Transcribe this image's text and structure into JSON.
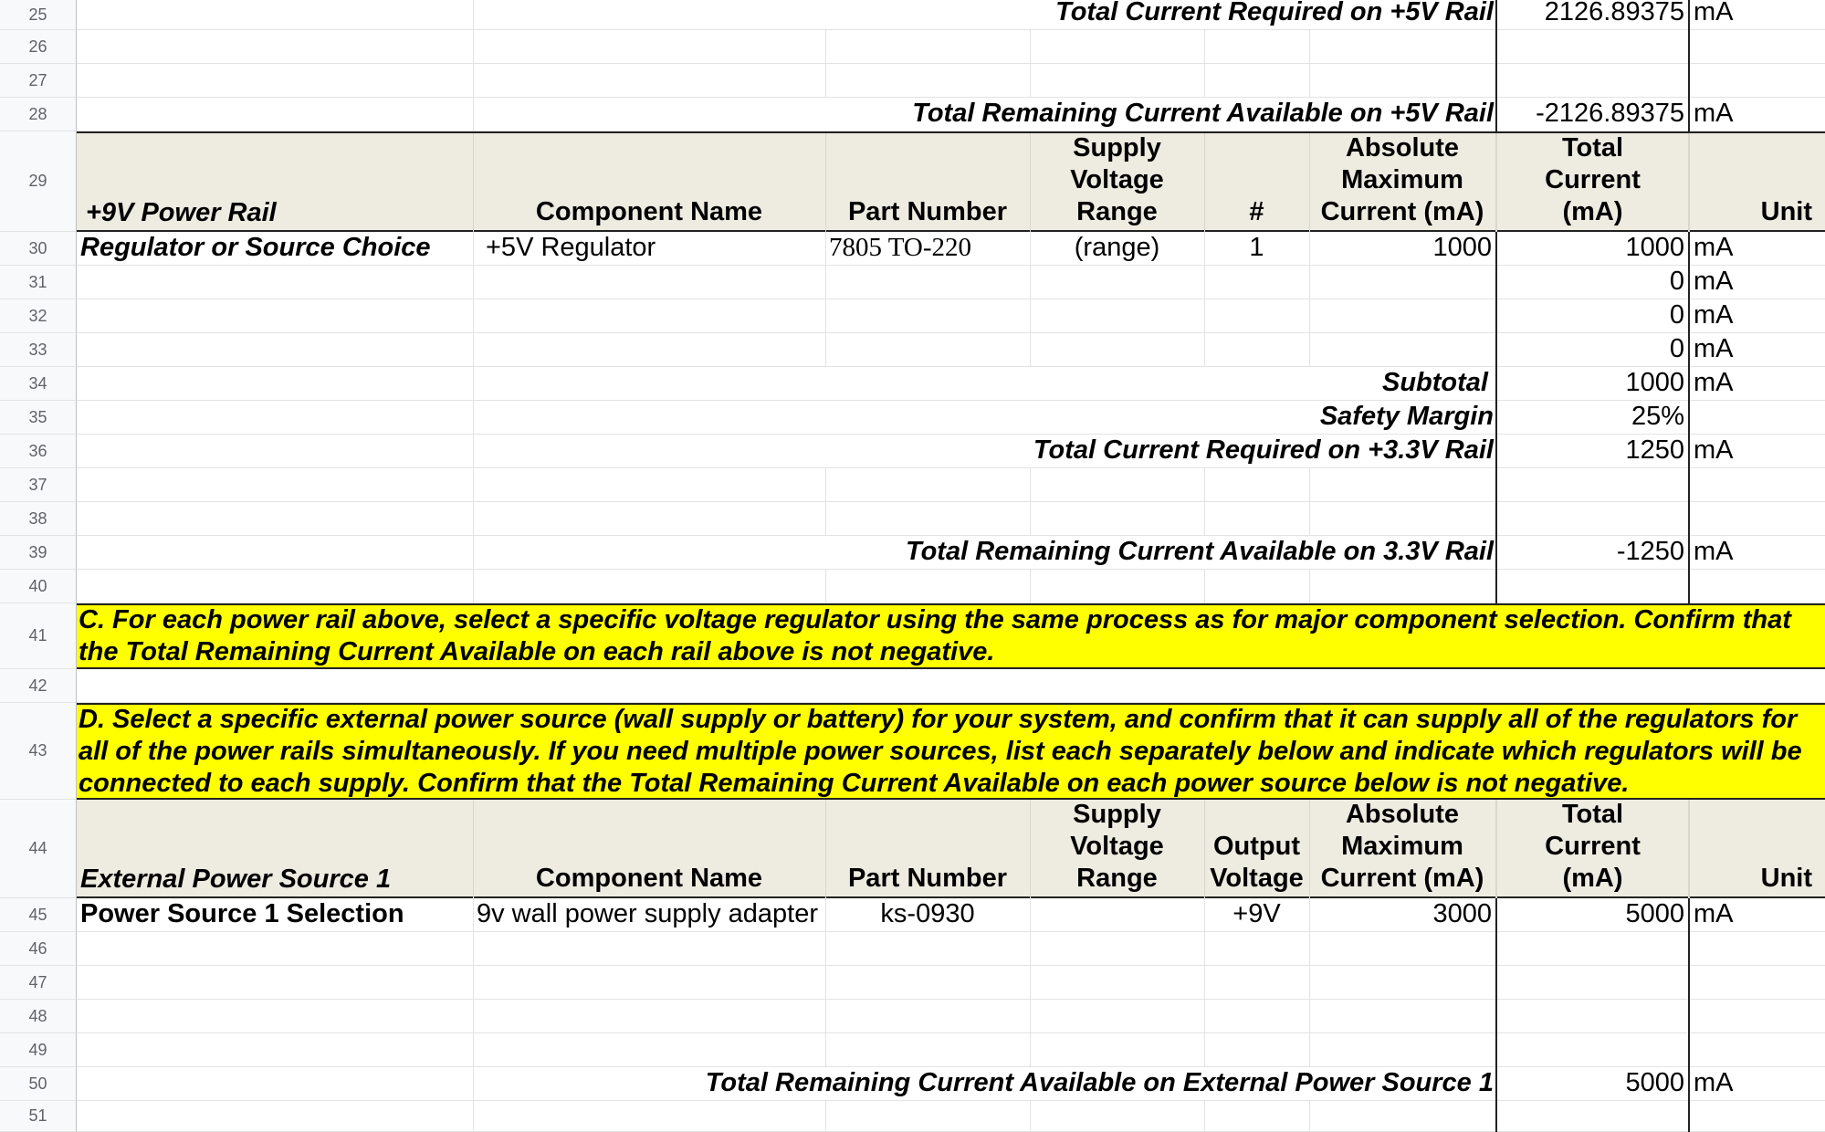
{
  "rows": {
    "r25": {
      "num": "25",
      "label": "Total Current Required on +5V Rail",
      "value": "2126.89375",
      "unit": "mA"
    },
    "r26": {
      "num": "26"
    },
    "r27": {
      "num": "27"
    },
    "r28": {
      "num": "28",
      "label": "Total Remaining Current Available on +5V Rail",
      "value": "-2126.89375",
      "unit": "mA"
    },
    "r29": {
      "num": "29"
    },
    "r30": {
      "num": "30",
      "col_a": "Regulator or Source Choice",
      "component": "+5V Regulator",
      "part": "7805 TO-220",
      "range": "(range)",
      "count": "1",
      "abs_max": "1000",
      "total": "1000",
      "unit": "mA"
    },
    "r31": {
      "num": "31",
      "total": "0",
      "unit": "mA"
    },
    "r32": {
      "num": "32",
      "total": "0",
      "unit": "mA"
    },
    "r33": {
      "num": "33",
      "total": "0",
      "unit": "mA"
    },
    "r34": {
      "num": "34",
      "label": "Subtotal",
      "value": "1000",
      "unit": "mA"
    },
    "r35": {
      "num": "35",
      "label": "Safety Margin",
      "value": "25%"
    },
    "r36": {
      "num": "36",
      "label": "Total Current Required on +3.3V Rail",
      "value": "1250",
      "unit": "mA"
    },
    "r37": {
      "num": "37"
    },
    "r38": {
      "num": "38"
    },
    "r39": {
      "num": "39",
      "label": "Total Remaining Current Available on 3.3V Rail",
      "value": "-1250",
      "unit": "mA"
    },
    "r40": {
      "num": "40"
    },
    "r41": {
      "num": "41",
      "text": "C. For each power rail above, select a specific voltage regulator using the same process as for major component selection. Confirm that the Total Remaining Current Available on each rail above is not negative."
    },
    "r42": {
      "num": "42"
    },
    "r43": {
      "num": "43",
      "text": "D. Select a specific external power source (wall supply or battery) for your system, and confirm that it can supply all of the regulators for all of the power rails simultaneously. If you need multiple power sources, list each separately below and indicate which regulators will be connected to each supply. Confirm that the Total Remaining Current Available on each power source below is not negative."
    },
    "r44": {
      "num": "44"
    },
    "r45": {
      "num": "45",
      "col_a": "Power Source 1 Selection",
      "component": "9v wall power supply adapter",
      "part": "ks-0930",
      "output": "+9V",
      "abs_max": "3000",
      "total": "5000",
      "unit": "mA"
    },
    "r46": {
      "num": "46"
    },
    "r47": {
      "num": "47"
    },
    "r48": {
      "num": "48"
    },
    "r49": {
      "num": "49"
    },
    "r50": {
      "num": "50",
      "label": "Total Remaining Current Available on External Power Source 1",
      "value": "5000",
      "unit": "mA"
    },
    "r51": {
      "num": "51"
    }
  },
  "header1": {
    "col_a": "+9V Power Rail",
    "component": "Component Name",
    "part": "Part Number",
    "supply_1": "Supply",
    "supply_2": "Voltage",
    "supply_3": "Range",
    "count": "#",
    "abs_1": "Absolute",
    "abs_2": "Maximum",
    "abs_3": "Current (mA)",
    "total_1": "Total",
    "total_2": "Current",
    "total_3": "(mA)",
    "unit": "Unit"
  },
  "header2": {
    "col_a": "External Power Source 1",
    "component": "Component Name",
    "part": "Part Number",
    "supply_1": "Supply",
    "supply_2": "Voltage",
    "supply_3": "Range",
    "out_1": "Output",
    "out_2": "Voltage",
    "abs_1": "Absolute",
    "abs_2": "Maximum",
    "abs_3": "Current (mA)",
    "total_1": "Total",
    "total_2": "Current",
    "total_3": "(mA)",
    "unit": "Unit"
  },
  "colors": {
    "header_bg": "#eeece1",
    "highlight": "#ffff00",
    "gridline": "#e2e3e3",
    "row_header_bg": "#f8f9fa"
  }
}
